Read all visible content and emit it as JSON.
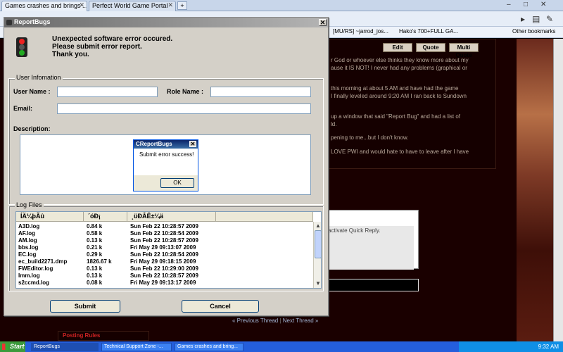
{
  "browser": {
    "tabs": [
      {
        "label": "Games crashes and brings ..."
      },
      {
        "label": "Perfect World Game Portal"
      }
    ],
    "bookmarks": [
      {
        "label": "[MU/RS] ~jarrod_jos..."
      },
      {
        "label": "Hako's 700+FULL GA..."
      },
      {
        "label": "Other bookmarks"
      }
    ]
  },
  "forum": {
    "buttons": [
      "Edit",
      "Quote",
      "Multi Quote"
    ],
    "post_lines": [
      "r God or whoever else thinks they know more about my",
      "ause it IS NOT! I never had any problems (graphical or",
      "this morning at about 5 AM and have had the game",
      "I finally leveled around 9:20 AM I ran back to Sundown",
      "up a window that said \"Report Bug\" and had a list of",
      "ld.",
      "pening to me...but I don't know.",
      "LOVE PWI and would hate to have to leave after I have"
    ],
    "quick_reply_text": "activate Quick Reply.",
    "prev_thread": "« Previous Thread",
    "next_thread": "Next Thread »",
    "posting_rules": "Posting Rules"
  },
  "dialog": {
    "title": "ReportBugs",
    "message_lines": [
      "Unexpected software error occured.",
      "Please submit error report.",
      "Thank you."
    ],
    "user_info_legend": "User Infomation",
    "user_name_label": "User Name :",
    "user_name_value": "",
    "role_name_label": "Role Name :",
    "role_name_value": "",
    "email_label": "Email:",
    "email_value": "",
    "description_label": "Description:",
    "log_files_legend": "Log Files",
    "columns": [
      "ÍÄ¼þÃû",
      "´óÐ¡",
      "¸üÐÂÊ±¼ä"
    ],
    "files": [
      {
        "name": "A3D.log",
        "size": "0.84 k",
        "time": "Sun Feb 22 10:28:57 2009"
      },
      {
        "name": "AF.log",
        "size": "0.58 k",
        "time": "Sun Feb 22 10:28:54 2009"
      },
      {
        "name": "AM.log",
        "size": "0.13 k",
        "time": "Sun Feb 22 10:28:57 2009"
      },
      {
        "name": "bbs.log",
        "size": "0.21 k",
        "time": "Fri May 29 09:13:07 2009"
      },
      {
        "name": "EC.log",
        "size": "0.29 k",
        "time": "Sun Feb 22 10:28:54 2009"
      },
      {
        "name": "ec_build2271.dmp",
        "size": "1826.67 k",
        "time": "Fri May 29 09:18:15 2009"
      },
      {
        "name": "FWEditor.log",
        "size": "0.13 k",
        "time": "Sun Feb 22 10:29:00 2009"
      },
      {
        "name": "Imm.log",
        "size": "0.13 k",
        "time": "Sun Feb 22 10:28:57 2009"
      },
      {
        "name": "s2ccmd.log",
        "size": "0.08 k",
        "time": "Fri May 29 09:13:17 2009"
      }
    ],
    "submit_label": "Submit",
    "cancel_label": "Cancel"
  },
  "popup": {
    "title": "CReportBugs",
    "message": "Submit error success!",
    "ok_label": "OK"
  },
  "taskbar": {
    "start_label": "Start",
    "tasks": [
      {
        "label": "ReportBugs"
      },
      {
        "label": "Technical Support Zone -..."
      },
      {
        "label": "Games crashes and bring..."
      }
    ],
    "clock": "9:32 AM"
  }
}
